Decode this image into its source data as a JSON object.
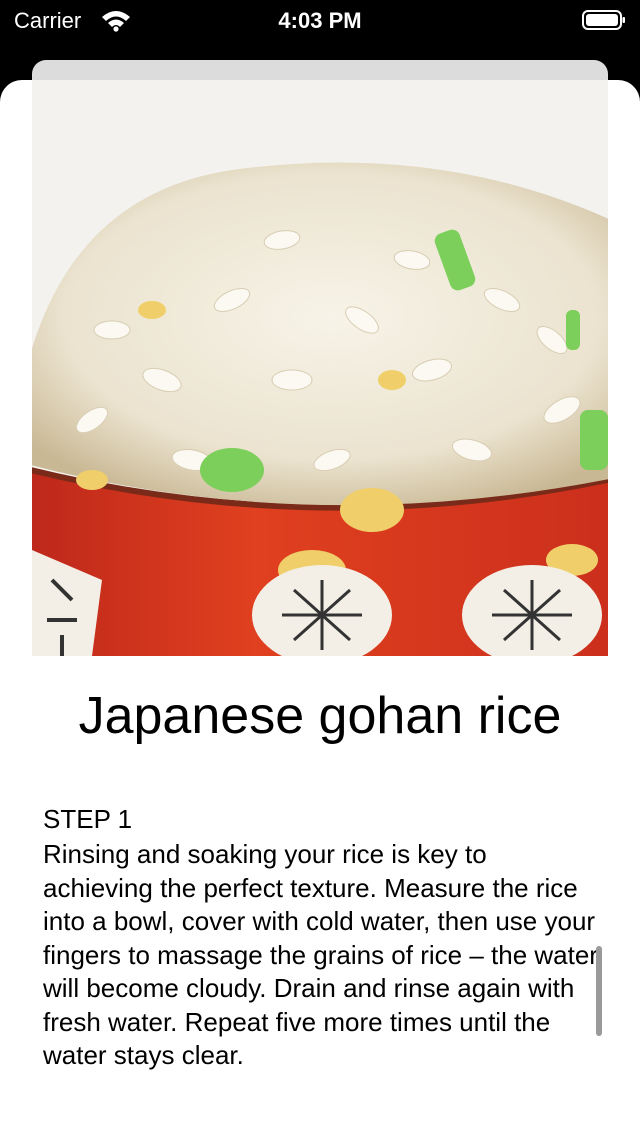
{
  "status_bar": {
    "carrier": "Carrier",
    "time": "4:03 PM",
    "wifi_icon": "wifi-icon",
    "battery_icon": "battery-icon"
  },
  "recipe": {
    "image_icon": "rice-bowl-photo",
    "title": "Japanese gohan rice",
    "steps": [
      {
        "heading": "STEP 1",
        "text": "Rinsing and soaking your rice is key to achieving the perfect texture. Measure the rice into a bowl, cover with cold water, then use your fingers to massage the grains of rice – the water will become cloudy. Drain and rinse again with fresh water. Repeat five more times until the water stays clear."
      }
    ]
  },
  "colors": {
    "bowl_red": "#d9321f",
    "background": "#000000",
    "sheet": "#ffffff"
  }
}
